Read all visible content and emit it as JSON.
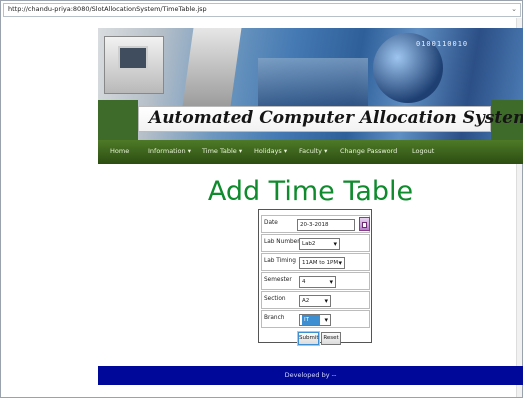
{
  "browser": {
    "url": "http://chandu-priya:8080/SlotAllocationSystem/TimeTable.jsp"
  },
  "banner": {
    "title": "Automated Computer Allocation System",
    "bits_text": "0100110010"
  },
  "nav": {
    "items": [
      {
        "label": "Home"
      },
      {
        "label": "Information ▾"
      },
      {
        "label": "Time Table ▾"
      },
      {
        "label": "Holidays ▾"
      },
      {
        "label": "Faculty ▾"
      },
      {
        "label": "Change Password"
      },
      {
        "label": "Logout"
      }
    ]
  },
  "page": {
    "heading": "Add Time Table"
  },
  "form": {
    "date": {
      "label": "Date",
      "value": "20-3-2018"
    },
    "lab_number": {
      "label": "Lab Number",
      "value": "Lab2"
    },
    "lab_timing": {
      "label": "Lab Timing",
      "value": "11AM to 1PM"
    },
    "semester": {
      "label": "Semester",
      "value": "4"
    },
    "section": {
      "label": "Section",
      "value": "A2"
    },
    "branch": {
      "label": "Branch",
      "value": "IT"
    },
    "submit_label": "Submit",
    "reset_label": "Reset"
  },
  "footer": {
    "text": "Developed by --"
  },
  "colors": {
    "heading": "#0f8b2d",
    "nav": "#3b6319",
    "footer": "#000899",
    "selected_option": "#3d8fd1"
  }
}
